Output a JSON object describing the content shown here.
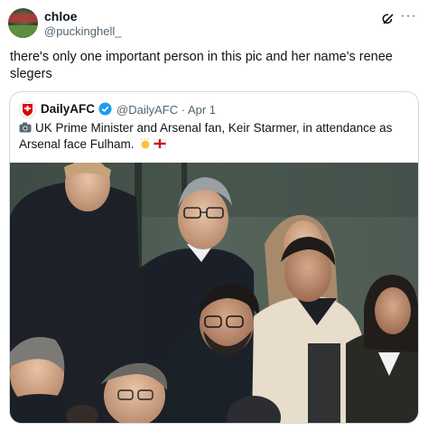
{
  "post": {
    "display_name": "chloe",
    "handle": "@puckinghell_",
    "text": "there's only one important person in this pic and her name's renee slegers",
    "icons": {
      "grok": "grok-icon",
      "more": "more-icon"
    }
  },
  "quote": {
    "display_name": "DailyAFC",
    "handle": "@DailyAFC",
    "separator": "·",
    "date": "Apr 1",
    "text": "UK Prime Minister and Arsenal fan, Keir Starmer, in attendance as Arsenal face Fulham.",
    "icons": [
      "camera-icon",
      "clap-icon",
      "england-flag-icon"
    ],
    "verified_color": "#1d9bf0"
  },
  "colors": {
    "text": "#0f1419",
    "muted": "#536471",
    "border": "#cfd9de",
    "accent": "#1d9bf0"
  }
}
